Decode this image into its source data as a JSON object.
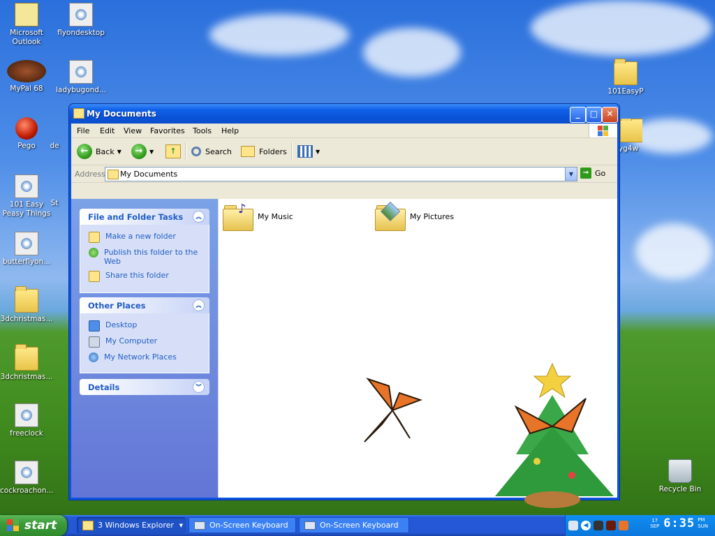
{
  "desktop": {
    "icons": [
      {
        "label": "Microsoft Outlook",
        "type": "outlook"
      },
      {
        "label": "flyondesktop",
        "type": "setup"
      },
      {
        "label": "MyPal 68",
        "type": "bug"
      },
      {
        "label": "ladybugond...",
        "type": "setup"
      },
      {
        "label": "Pego",
        "type": "red"
      },
      {
        "label": "de",
        "type": "setup"
      },
      {
        "label": "101 Easy Peasy Things",
        "type": "setup"
      },
      {
        "label": "St",
        "type": "setup"
      },
      {
        "label": "butterflyon...",
        "type": "setup"
      },
      {
        "label": "3dchristmas...",
        "type": "zip"
      },
      {
        "label": "3dchristmas...",
        "type": "folder"
      },
      {
        "label": "freeclock",
        "type": "setup"
      },
      {
        "label": "cockroachon...",
        "type": "setup"
      },
      {
        "label": "101EasyP",
        "type": "folder"
      },
      {
        "label": "yg4w",
        "type": "folder"
      },
      {
        "label": "Recycle Bin",
        "type": "bin"
      }
    ]
  },
  "window": {
    "title": "My Documents",
    "menu": [
      "File",
      "Edit",
      "View",
      "Favorites",
      "Tools",
      "Help"
    ],
    "toolbar": {
      "back": "Back",
      "search": "Search",
      "folders": "Folders"
    },
    "address": {
      "label": "Address",
      "value": "My Documents",
      "go": "Go"
    },
    "tasks_panel": {
      "title": "File and Folder Tasks",
      "items": [
        "Make a new folder",
        "Publish this folder to the Web",
        "Share this folder"
      ]
    },
    "places_panel": {
      "title": "Other Places",
      "items": [
        "Desktop",
        "My Computer",
        "My Network Places"
      ]
    },
    "details_panel": {
      "title": "Details"
    },
    "files": [
      {
        "name": "My Music",
        "icon": "music-folder-icon"
      },
      {
        "name": "My Pictures",
        "icon": "pictures-folder-icon"
      }
    ]
  },
  "taskbar": {
    "start": "start",
    "tasks": [
      {
        "label": "3 Windows Explorer",
        "active": true
      },
      {
        "label": "On-Screen Keyboard",
        "active": false
      },
      {
        "label": "On-Screen Keyboard",
        "active": false
      }
    ],
    "clock": {
      "date_top": "17",
      "date_bottom": "SEP",
      "time": "6:35",
      "period": "PM",
      "day": "SUN"
    }
  },
  "colors": {
    "titlebar": "#0a54e0",
    "taskpane_link": "#215dc6",
    "start_green": "#3c9a3a"
  }
}
